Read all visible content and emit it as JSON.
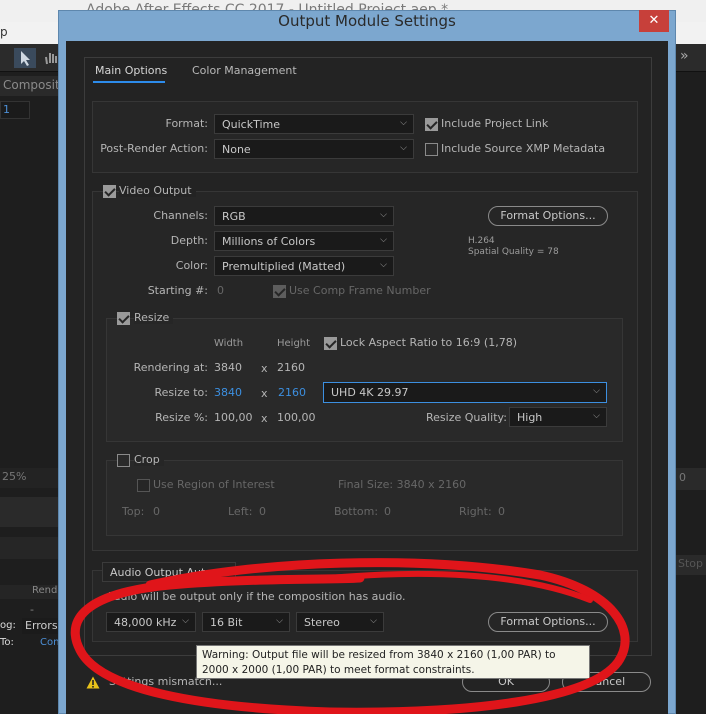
{
  "app": {
    "title": "Adobe After Effects CC 2017 - Untitled Project.aep *",
    "menu_fragment": "p",
    "composition_tab": "Composition",
    "comp_field": "1",
    "zoom": "25%",
    "render_header": "Rende",
    "log_label": "og:",
    "log_value": "Errors",
    "to_label": "To:",
    "to_value": "Con",
    "right_zoom_fragment": "0",
    "stop_fragment": "Stop",
    "chevrons": "»",
    "dash": "-"
  },
  "dialog": {
    "title": "Output Module Settings",
    "close_glyph": "✕",
    "tabs": [
      {
        "label": "Main Options",
        "active": true
      },
      {
        "label": "Color Management",
        "active": false
      }
    ],
    "format": {
      "label": "Format:",
      "value": "QuickTime",
      "include_project_link": {
        "label": "Include Project Link",
        "checked": true
      }
    },
    "post_render": {
      "label": "Post-Render Action:",
      "value": "None",
      "include_xmp": {
        "label": "Include Source XMP Metadata",
        "checked": false
      }
    },
    "video_output": {
      "label": "Video Output",
      "checked": true,
      "channels": {
        "label": "Channels:",
        "value": "RGB"
      },
      "depth": {
        "label": "Depth:",
        "value": "Millions of Colors"
      },
      "color": {
        "label": "Color:",
        "value": "Premultiplied (Matted)"
      },
      "starting": {
        "label": "Starting #:",
        "value": "0"
      },
      "use_comp_frame": {
        "label": "Use Comp Frame Number",
        "checked": true
      },
      "format_options_button": "Format Options...",
      "codec": "H.264",
      "quality": "Spatial Quality = 78"
    },
    "resize": {
      "label": "Resize",
      "checked": true,
      "width_header": "Width",
      "height_header": "Height",
      "lock_aspect": {
        "label": "Lock Aspect Ratio to 16:9 (1,78)",
        "checked": true
      },
      "rendering_at": {
        "label": "Rendering at:",
        "width": "3840",
        "height": "2160"
      },
      "resize_to": {
        "label": "Resize to:",
        "width": "3840",
        "height": "2160",
        "preset": "UHD 4K 29.97"
      },
      "resize_pct": {
        "label": "Resize %:",
        "width": "100,00",
        "height": "100,00"
      },
      "x": "x",
      "quality": {
        "label": "Resize Quality:",
        "value": "High"
      }
    },
    "crop": {
      "label": "Crop",
      "checked": false,
      "use_roi": {
        "label": "Use Region of Interest",
        "checked": false
      },
      "final_size": "Final Size: 3840 x 2160",
      "top": {
        "label": "Top:",
        "value": "0"
      },
      "left": {
        "label": "Left:",
        "value": "0"
      },
      "bottom": {
        "label": "Bottom:",
        "value": "0"
      },
      "right": {
        "label": "Right:",
        "value": "0"
      }
    },
    "audio": {
      "label": "Audio Output Auto",
      "note": "Audio will be output only if the composition has audio.",
      "rate": "48,000 kHz",
      "bits": "16 Bit",
      "channels": "Stereo",
      "format_options_button": "Format Options..."
    },
    "tooltip": "Warning: Output file will be resized from 3840 x 2160 (1,00 PAR) to 2000 x 2000 (1,00 PAR) to meet format constraints.",
    "mismatch": "Settings mismatch...",
    "ok_button": "OK",
    "cancel_button": "Cancel"
  },
  "colors": {
    "accent": "#2d8ceb",
    "warning": "#e8c21a",
    "annotation": "#e0151a"
  }
}
